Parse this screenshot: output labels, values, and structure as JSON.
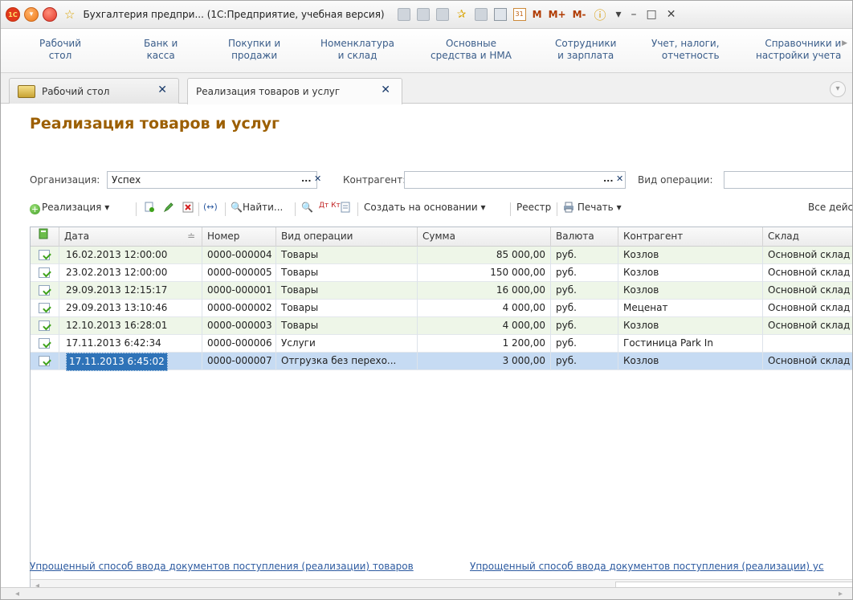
{
  "window": {
    "title": "Бухгалтерия предпри... (1С:Предприятие, учебная версия)",
    "memory_buttons": [
      "M",
      "M+",
      "M-"
    ]
  },
  "sections": [
    {
      "line1": "Рабочий",
      "line2": "стол"
    },
    {
      "line1": "Банк и",
      "line2": "касса"
    },
    {
      "line1": "Покупки и",
      "line2": "продажи"
    },
    {
      "line1": "Номенклатура",
      "line2": "и склад"
    },
    {
      "line1": "Основные",
      "line2": "средства и НМА"
    },
    {
      "line1": "Сотрудники",
      "line2": "и зарплата"
    },
    {
      "line1": "Учет, налоги,",
      "line2": "отчетность"
    },
    {
      "line1": "Справочники и",
      "line2": "настройки учета"
    }
  ],
  "tabs": [
    {
      "label": "Рабочий стол"
    },
    {
      "label": "Реализация товаров и услуг"
    }
  ],
  "form": {
    "title": "Реализация товаров и услуг",
    "filters": {
      "organization_label": "Организация:",
      "organization_value": "Успех",
      "counterparty_label": "Контрагент:",
      "counterparty_value": "",
      "operation_label": "Вид операции:",
      "operation_value": ""
    },
    "toolbar": {
      "create_label": "Реализация",
      "find_label": "Найти...",
      "create_based_label": "Создать на основании",
      "registry_label": "Реестр",
      "print_label": "Печать",
      "all_actions_label": "Все дейс",
      "dt_kt_label": "Дт Кт"
    }
  },
  "table": {
    "columns": [
      "Дата",
      "Номер",
      "Вид операции",
      "Сумма",
      "Валюта",
      "Контрагент",
      "Склад"
    ],
    "rows": [
      {
        "date": "16.02.2013 12:00:00",
        "number": "0000-000004",
        "operation": "Товары",
        "sum": "85 000,00",
        "currency": "руб.",
        "counterparty": "Козлов",
        "warehouse": "Основной склад"
      },
      {
        "date": "23.02.2013 12:00:00",
        "number": "0000-000005",
        "operation": "Товары",
        "sum": "150 000,00",
        "currency": "руб.",
        "counterparty": "Козлов",
        "warehouse": "Основной склад"
      },
      {
        "date": "29.09.2013 12:15:17",
        "number": "0000-000001",
        "operation": "Товары",
        "sum": "16 000,00",
        "currency": "руб.",
        "counterparty": "Козлов",
        "warehouse": "Основной склад"
      },
      {
        "date": "29.09.2013 13:10:46",
        "number": "0000-000002",
        "operation": "Товары",
        "sum": "4 000,00",
        "currency": "руб.",
        "counterparty": "Меценат",
        "warehouse": "Основной склад"
      },
      {
        "date": "12.10.2013 16:28:01",
        "number": "0000-000003",
        "operation": "Товары",
        "sum": "4 000,00",
        "currency": "руб.",
        "counterparty": "Козлов",
        "warehouse": "Основной склад"
      },
      {
        "date": "17.11.2013 6:42:34",
        "number": "0000-000006",
        "operation": "Услуги",
        "sum": "1 200,00",
        "currency": "руб.",
        "counterparty": "Гостиница Park In",
        "warehouse": ""
      },
      {
        "date": "17.11.2013 6:45:02",
        "number": "0000-000007",
        "operation": "Отгрузка без перехо...",
        "sum": "3 000,00",
        "currency": "руб.",
        "counterparty": "Козлов",
        "warehouse": "Основной склад"
      }
    ]
  },
  "links": [
    "Упрощенный способ ввода документов поступления (реализации) товаров",
    "Упрощенный способ ввода документов поступления (реализации) ус"
  ],
  "colors": {
    "title_orange": "#9c5f00",
    "section_blue": "#3a5d8a",
    "link_blue": "#2c5aa0",
    "row_green": "#eef6e8",
    "row_selected": "#c6dbf3"
  }
}
